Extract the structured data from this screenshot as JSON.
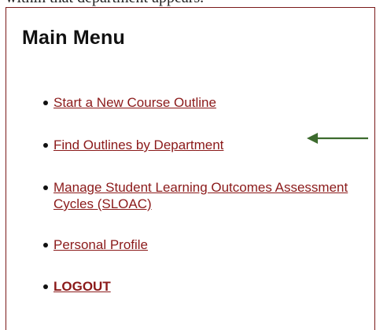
{
  "caption_fragment": "within that department appears.",
  "menu": {
    "title": "Main Menu",
    "items": [
      {
        "label": "Start a New Course Outline"
      },
      {
        "label": "Find Outlines by Department"
      },
      {
        "label": "Manage Student Learning Outcomes Assessment Cycles (SLOAC)"
      },
      {
        "label": "Personal Profile"
      },
      {
        "label": "LOGOUT"
      }
    ]
  },
  "colors": {
    "link": "#8b1a1a",
    "panel_border": "#7a1a1a",
    "arrow": "#3d6b2e"
  },
  "annotation": {
    "arrow_icon": "left-arrow-icon",
    "points_to_item": 2
  }
}
